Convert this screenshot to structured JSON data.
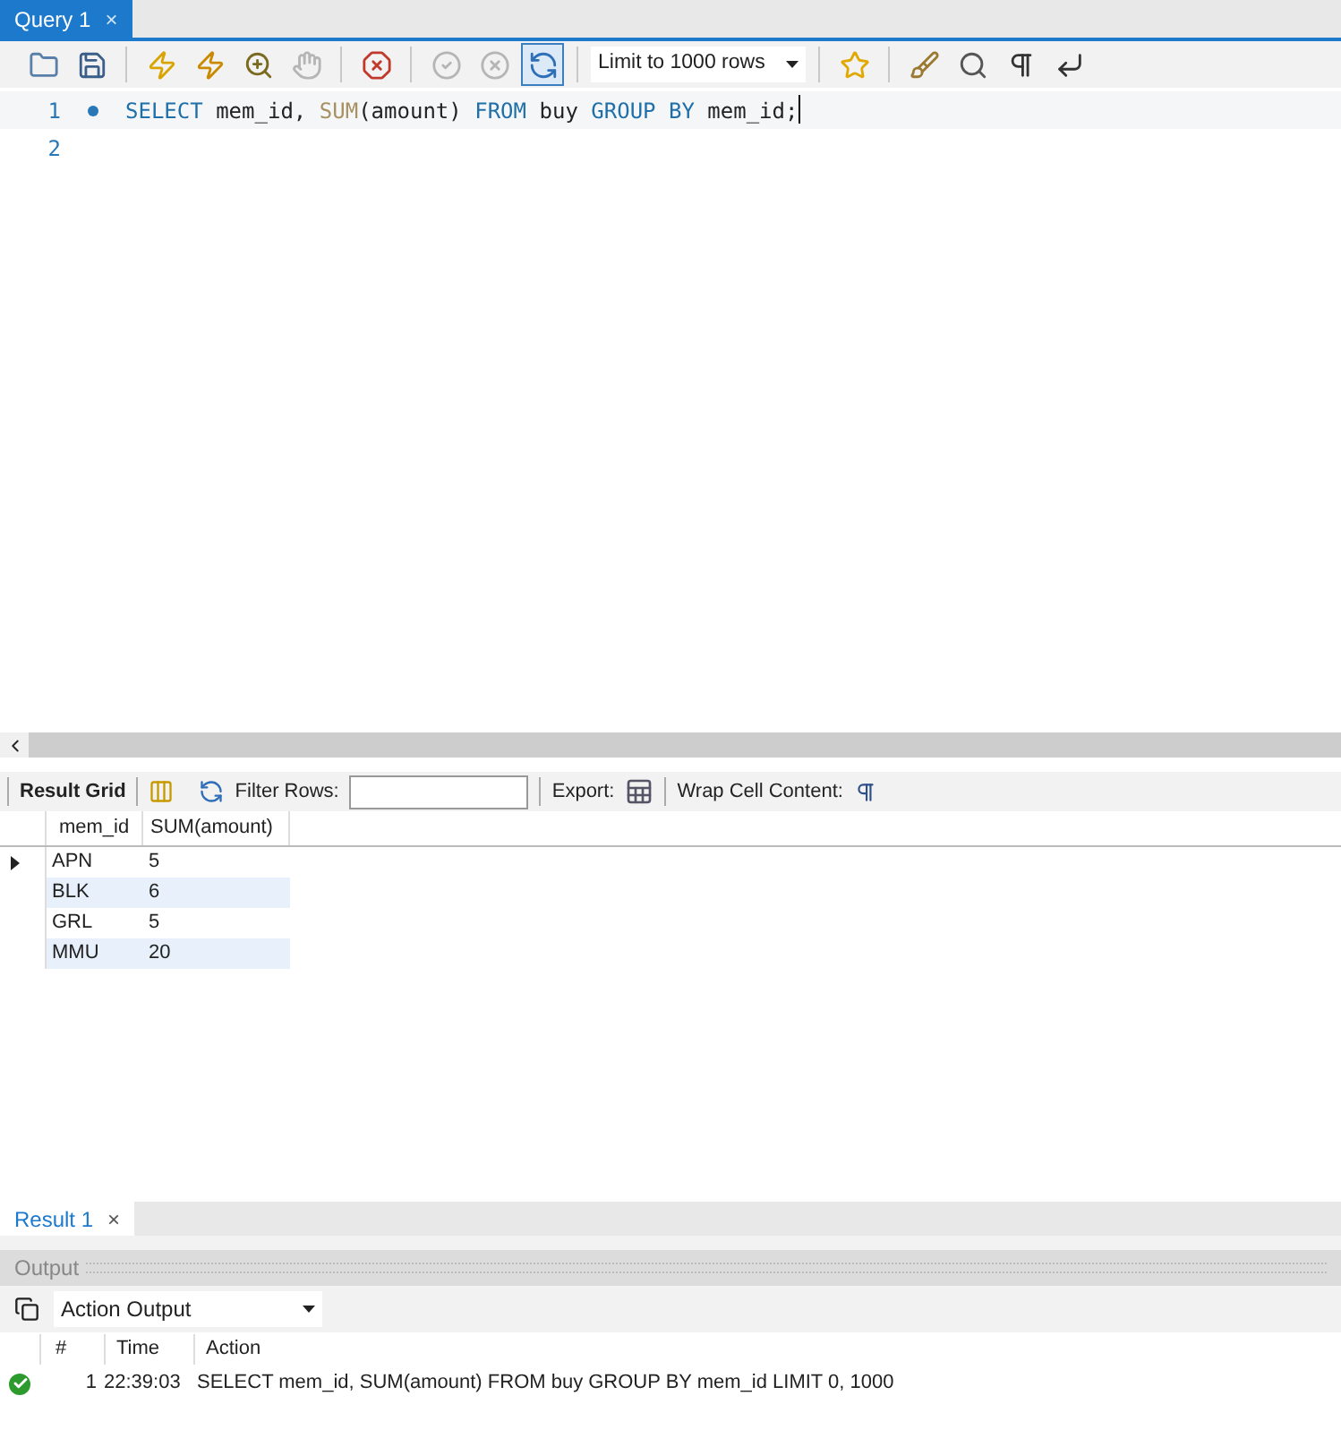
{
  "query_tab": {
    "label": "Query 1",
    "selected": true,
    "close": "×"
  },
  "toolbar": {
    "buttons": [
      {
        "kind": "folder",
        "disabled": false
      },
      {
        "kind": "save",
        "disabled": false
      },
      {
        "kind": "separator"
      },
      {
        "kind": "bolt",
        "disabled": false
      },
      {
        "kind": "bolt-cursor",
        "disabled": false
      },
      {
        "kind": "explain",
        "disabled": false
      },
      {
        "kind": "stop",
        "disabled": true
      },
      {
        "kind": "separator"
      },
      {
        "kind": "error-stop",
        "disabled": false
      },
      {
        "kind": "separator"
      },
      {
        "kind": "commit",
        "disabled": true
      },
      {
        "kind": "rollback",
        "disabled": true
      },
      {
        "kind": "autocommit",
        "disabled": false,
        "selected": true
      }
    ],
    "limit": "Limit to 1000 rows",
    "buttons_right": [
      {
        "kind": "star-add"
      },
      {
        "kind": "separator"
      },
      {
        "kind": "broom"
      },
      {
        "kind": "find"
      },
      {
        "kind": "pilcrow"
      },
      {
        "kind": "wrap"
      }
    ]
  },
  "editor": {
    "lines": [
      {
        "number": "1",
        "marker": true,
        "tokens": [
          {
            "kind": "keyword",
            "text": "SELECT"
          },
          {
            "kind": "plain",
            "text": " mem_id, "
          },
          {
            "kind": "function",
            "text": "SUM"
          },
          {
            "kind": "plain",
            "text": "(amount) "
          },
          {
            "kind": "keyword",
            "text": "FROM"
          },
          {
            "kind": "plain",
            "text": " buy "
          },
          {
            "kind": "keyword",
            "text": "GROUP BY"
          },
          {
            "kind": "plain",
            "text": " mem_id;"
          }
        ],
        "cursor": true
      },
      {
        "number": "2",
        "marker": false,
        "cursor": false
      }
    ]
  },
  "result_toolbar": {
    "result_grid": "Result Grid",
    "filter_label": "Filter Rows:",
    "export_label": "Export:",
    "wrap_label": "Wrap Cell Content:"
  },
  "grid": {
    "columns": [
      "mem_id",
      "SUM(amount)"
    ],
    "rows": [
      {
        "current": true,
        "cells": [
          "APN",
          "5"
        ]
      },
      {
        "current": false,
        "cells": [
          "BLK",
          "6"
        ]
      },
      {
        "current": false,
        "cells": [
          "GRL",
          "5"
        ]
      },
      {
        "current": false,
        "cells": [
          "MMU",
          "20"
        ]
      }
    ]
  },
  "result_tab": {
    "label": "Result 1",
    "selected": true,
    "close": "×"
  },
  "output": {
    "title": "Output",
    "selector": "Action Output",
    "columns": [
      "#",
      "Time",
      "Action"
    ],
    "rows": [
      {
        "kind": "success",
        "number": "1",
        "time": "22:39:03",
        "action": "SELECT mem_id, SUM(amount) FROM buy GROUP BY mem_id LIMIT 0, 1000"
      }
    ]
  }
}
